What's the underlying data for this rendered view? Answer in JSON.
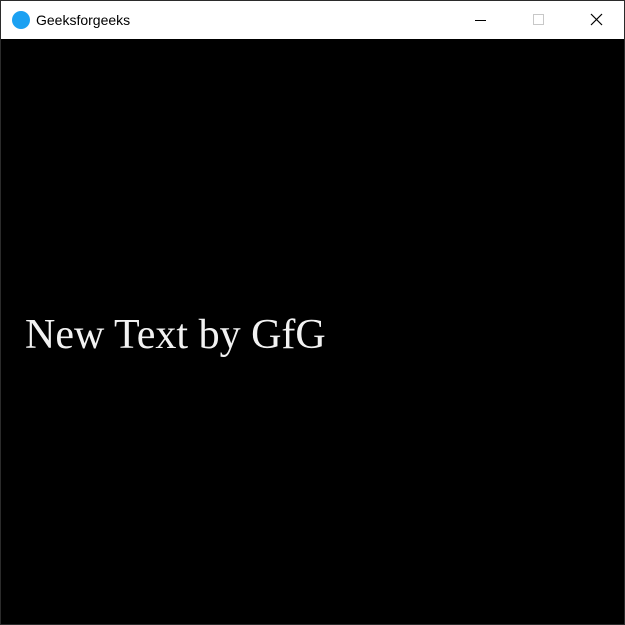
{
  "window": {
    "title": "Geeksforgeeks",
    "icon": "app-circle-icon",
    "icon_color": "#1ba1f2",
    "controls": [
      "minimize-icon",
      "maximize-icon",
      "close-icon"
    ]
  },
  "canvas": {
    "background": "#000000",
    "text": "New Text by GfG",
    "text_color": "#f2f2f2"
  }
}
